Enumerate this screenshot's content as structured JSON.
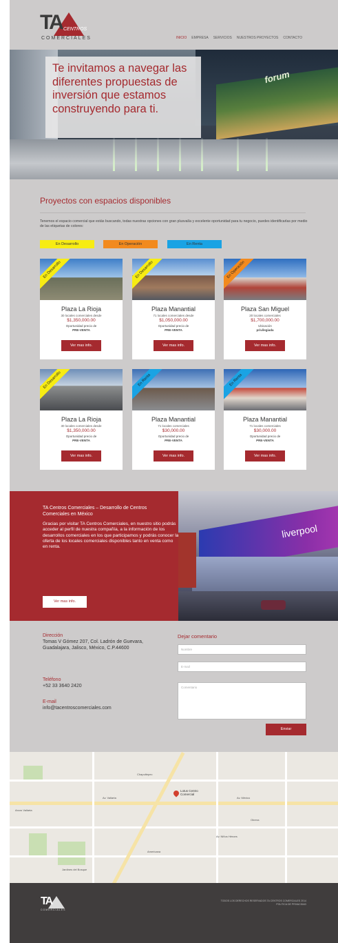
{
  "header": {
    "logo_text": "TA",
    "logo_centros": "CENTROS",
    "logo_comerciales": "COMERCIALES",
    "nav": [
      "INICIO",
      "EMPRESA",
      "SERVICIOS",
      "NUESTROS PROYECTOS",
      "CONTACTO"
    ]
  },
  "hero": {
    "headline": "Te invitamos a navegar las diferentes propuestas de inversión que estamos construyendo para ti.",
    "sign_text": "forum"
  },
  "projects": {
    "title": "Proyectos con espacios disponibles",
    "description": "Tenemos el espacio comercial que estás buscando, todas nuestras opciones con gran plusvalía y excelente oportunidad para tu negocio, puedes identificarlas por medio de las etiquetas de colores:",
    "legend": [
      {
        "label": "En Desarrollo",
        "color": "#f7ec13"
      },
      {
        "label": "En Operación",
        "color": "#f28a1e"
      },
      {
        "label": "En Renta",
        "color": "#1aa3e4"
      }
    ],
    "cards": [
      {
        "ribbon": "En Desarrollo",
        "ribbon_color": "#f7ec13",
        "name": "Plaza La Rioja",
        "sub": "30 locales comerciales desde",
        "price": "$1,350,000.00",
        "note1": "Oportunidad precio de",
        "note2": "PRE-VENTA",
        "button": "Ver mas info."
      },
      {
        "ribbon": "En Desarrollo",
        "ribbon_color": "#f7ec13",
        "name": "Plaza Manantial",
        "sub": "71 locales comerciales desde",
        "price": "$1,050,000.00",
        "note1": "Oportunidad precio de",
        "note2": "PRE-VENTA",
        "button": "Ver mas info."
      },
      {
        "ribbon": "En Operación",
        "ribbon_color": "#f28a1e",
        "name": "Plaza San Miguel",
        "sub": "20 locales comerciales",
        "price": "$1,700,000.00",
        "note1": "Ubicación",
        "note2": "privilegiada",
        "button": "Ver mas info."
      },
      {
        "ribbon": "En Desarrollo",
        "ribbon_color": "#f7ec13",
        "name": "Plaza La Rioja",
        "sub": "30 locales comerciales desde",
        "price": "$1,350,000.00",
        "note1": "Oportunidad precio de",
        "note2": "PRE-VENTA",
        "button": "Ver mas info."
      },
      {
        "ribbon": "En Renta",
        "ribbon_color": "#1aa3e4",
        "name": "Plaza Manantial",
        "sub": "71 locales comerciales",
        "price": "$30,000.00",
        "note1": "Oportunidad precio de",
        "note2": "PRE-VENTA",
        "button": "Ver mas info."
      },
      {
        "ribbon": "En Renta",
        "ribbon_color": "#1aa3e4",
        "name": "Plaza Manantial",
        "sub": "71 locales comerciales",
        "price": "$30,000.00",
        "note1": "Oportunidad precio de",
        "note2": "PRE-VENTA",
        "button": "Ver mas info."
      }
    ]
  },
  "about": {
    "title": "TA Centros Comerciales – Desarrollo de Centros Comerciales en México",
    "text": "Gracias por visitar TA Centros Comerciales, en nuestro sitio podrás acceder al perfil de nuestra compañía, a la información de los desarrollos comerciales en los que participamos y podrás conocer la oferta de los locales comerciales disponibles tanto en venta como en renta.",
    "button": "Ver mas info.",
    "sign_text": "liverpool"
  },
  "contact": {
    "address_label": "Dirección",
    "address": "Tomas V Gómez 207, Col. Ladrón de Guevara, Guadalajara, Jalisco, México, C.P.44600",
    "phone_label": "Teléfono",
    "phone": "+52 33 3640 2420",
    "email_label": "E-mail",
    "email": "info@tacentroscomerciales.com",
    "form_title": "Dejar comentario",
    "name_placeholder": "Nombre",
    "email_placeholder": "E-mail",
    "comment_placeholder": "Comentario",
    "submit": "Enviar"
  },
  "map": {
    "place": "Lotus Centro Comercial",
    "labels": [
      "Av. Vallarta",
      "Av. México",
      "Chapultepec",
      "Av. Niños Héroes",
      "Americana",
      "Obrera",
      "Arcos Vallarta",
      "Jardines del Bosque"
    ]
  },
  "footer": {
    "logo_text": "TA",
    "logo_sub": "COMERCIALES",
    "copyright": "TODOS LOS DERECHOS RESERVADOS TA CENTROS COMERCIALES 2014",
    "policy": "POLITICA DE PRIVACIDAD"
  }
}
